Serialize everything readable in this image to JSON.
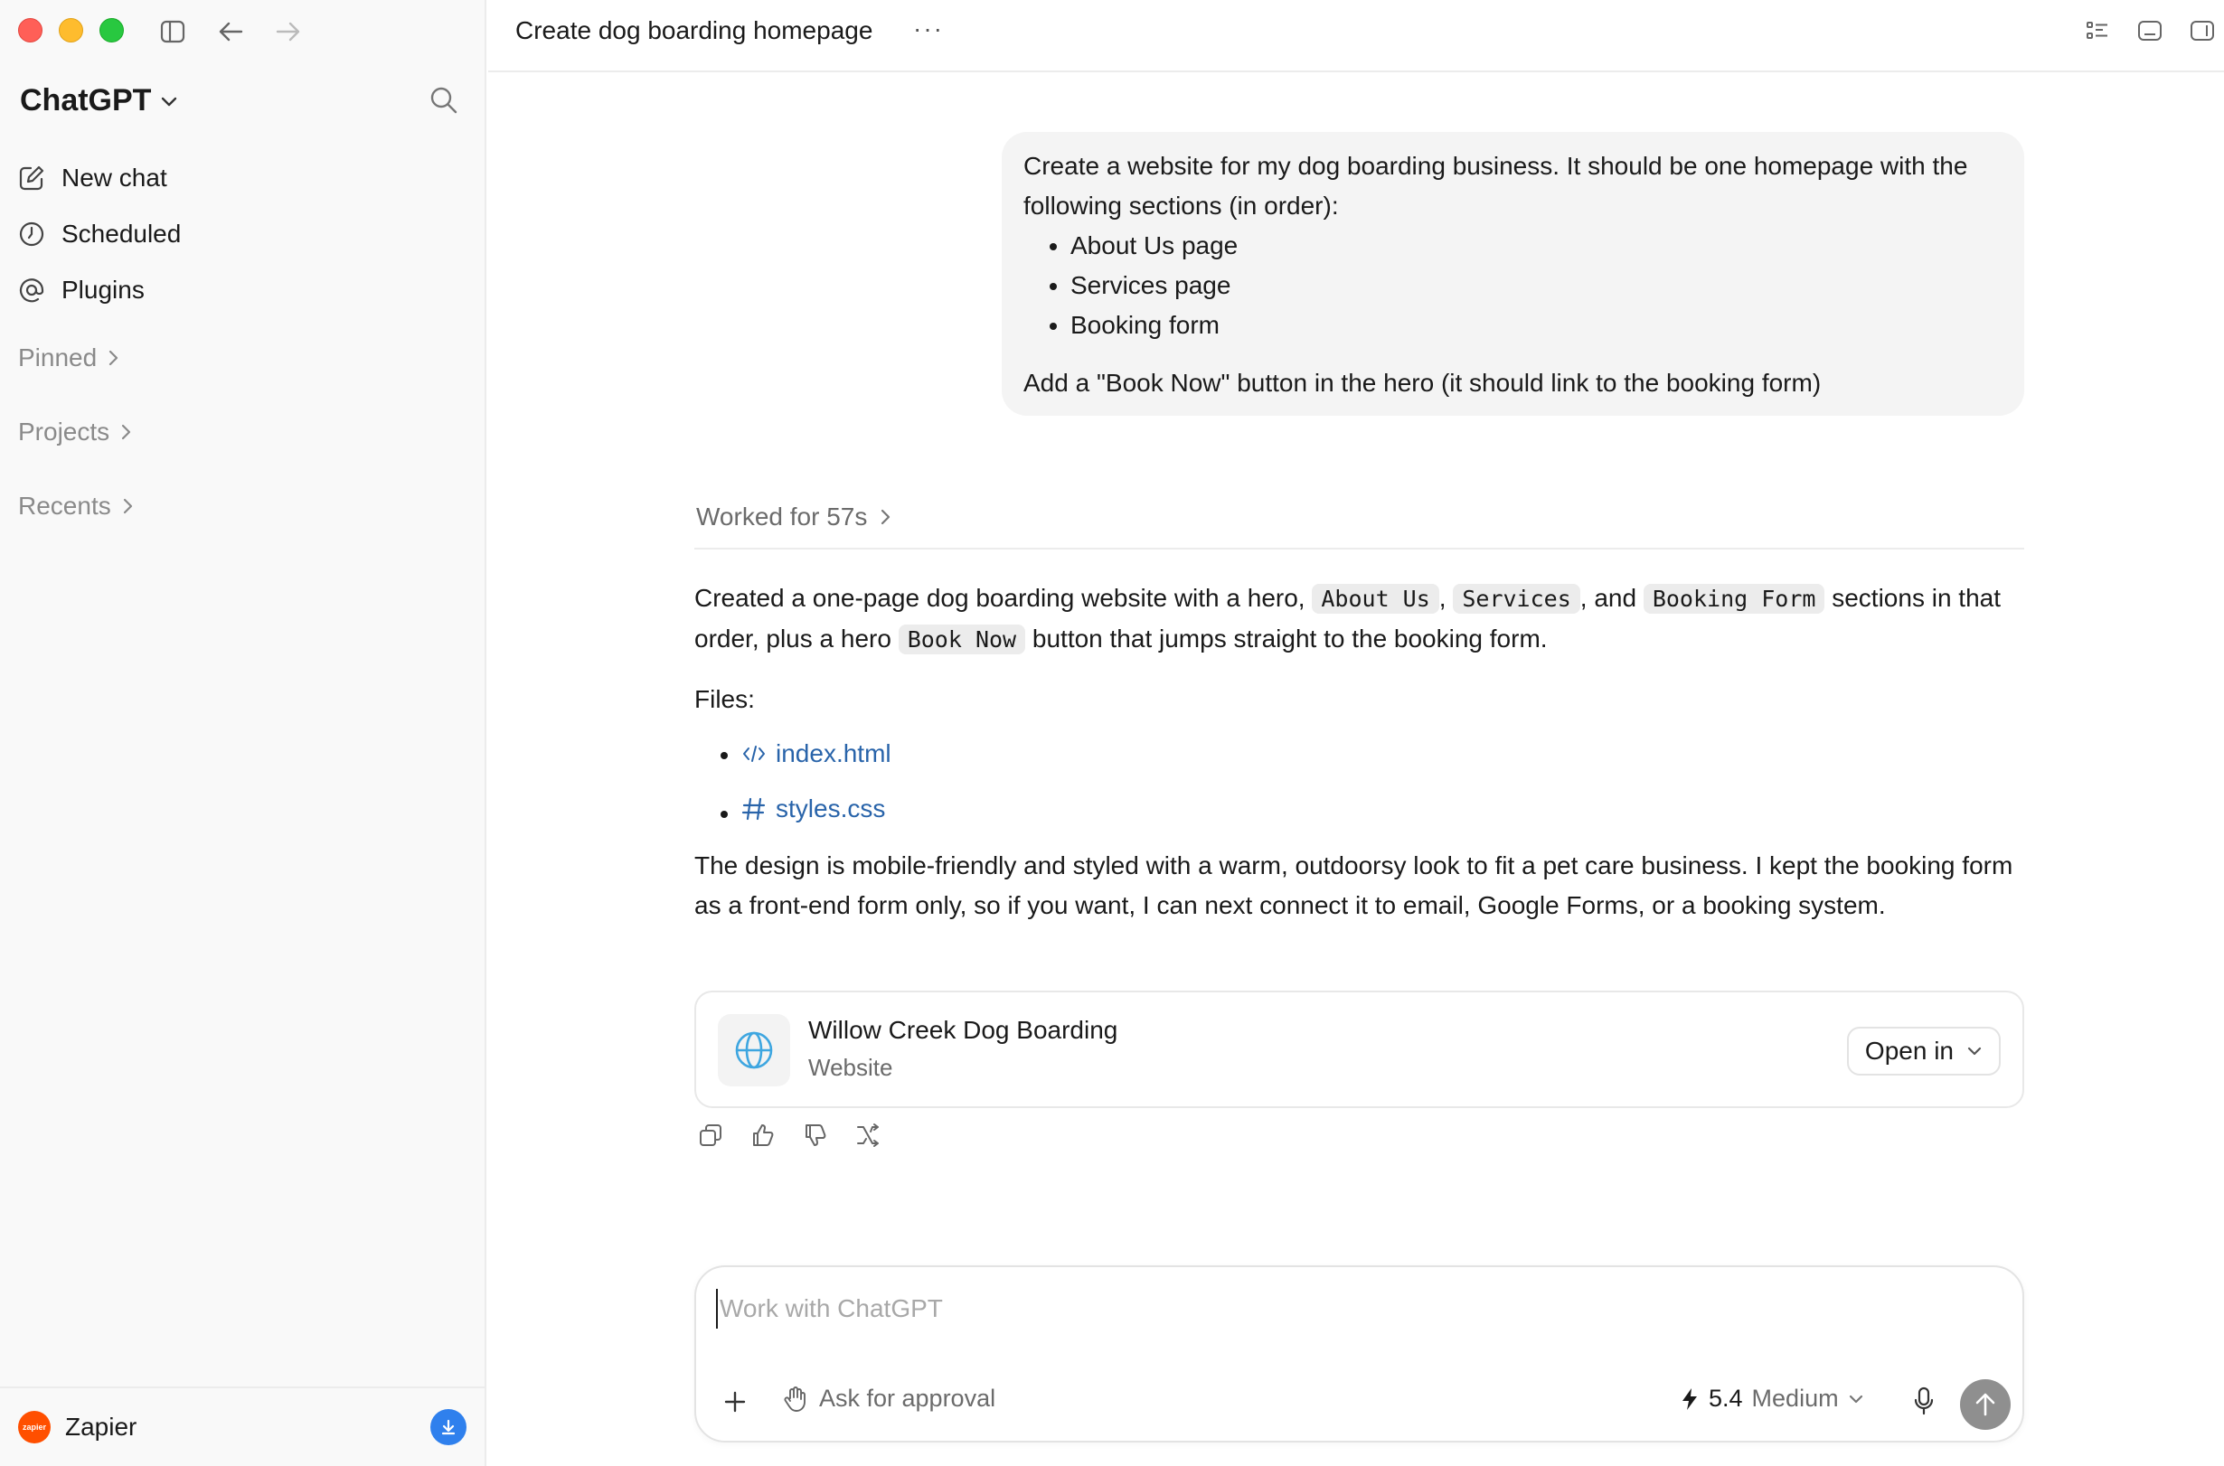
{
  "sidebar": {
    "brand": "ChatGPT",
    "nav": [
      {
        "label": "New chat",
        "icon": "edit-icon"
      },
      {
        "label": "Scheduled",
        "icon": "clock-icon"
      },
      {
        "label": "Plugins",
        "icon": "at-icon"
      }
    ],
    "sections": [
      "Pinned",
      "Projects",
      "Recents"
    ],
    "footer": {
      "workspace": "Zapier",
      "logo_text": "zapier"
    }
  },
  "header": {
    "title": "Create dog boarding homepage",
    "more": "···"
  },
  "user_message": {
    "intro": "Create a website for my dog boarding business. It should be one homepage with the following sections (in order):",
    "items": [
      "About Us page",
      "Services page",
      "Booking form"
    ],
    "outro": "Add a \"Book Now\" button in the hero (it should link to the booking form)"
  },
  "assistant": {
    "worked": "Worked for 57s",
    "p1_a": "Created a one-page dog boarding website with a hero, ",
    "code1": "About Us",
    "sep1": ", ",
    "code2": "Services",
    "sep2": ", and ",
    "code3": "Booking Form",
    "p1_b": " sections in that order, plus a hero ",
    "code4": "Book Now",
    "p1_c": " button that jumps straight to the booking form.",
    "files_label": "Files:",
    "files": [
      {
        "name": "index.html",
        "icon": "code-file-icon"
      },
      {
        "name": "styles.css",
        "icon": "hash-icon"
      }
    ],
    "p2": "The design is mobile-friendly and styled with a warm, outdoorsy look to fit a pet care business. I kept the booking form as a front-end form only, so if you want, I can next connect it to email, Google Forms, or a booking system.",
    "card": {
      "title": "Willow Creek Dog Boarding",
      "subtitle": "Website",
      "open_label": "Open in"
    }
  },
  "composer": {
    "placeholder": "Work with ChatGPT",
    "approval": "Ask for approval",
    "model_version": "5.4",
    "model_effort": "Medium"
  },
  "colors": {
    "accent_link": "#2964aa",
    "sidebar_bg": "#f9f9f9",
    "zapier": "#ff4f00",
    "download": "#2f80ed"
  }
}
